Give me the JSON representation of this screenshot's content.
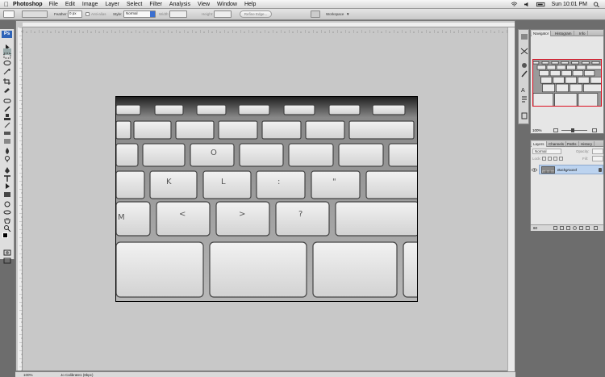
{
  "menubar": {
    "app_name": "Photoshop",
    "menus": [
      "File",
      "Edit",
      "Image",
      "Layer",
      "Select",
      "Filter",
      "Analysis",
      "View",
      "Window",
      "Help"
    ],
    "clock": "Sun 10:01 PM"
  },
  "options_bar": {
    "feather_label": "Feather:",
    "feather_value": "0 px",
    "anti_alias_label": "Anti-alias",
    "style_label": "Style:",
    "style_value": "Normal",
    "width_label": "Width:",
    "height_label": "Height:",
    "refine_edge_label": "Refine Edge...",
    "workspace_label": "Workspace"
  },
  "toolbox": {
    "logo": "Ps"
  },
  "status_bar": {
    "zoom": "100%",
    "document_info": "Jo Calibrate1 (8bpc)"
  },
  "navigator_panel": {
    "tabs": [
      "Navigator",
      "Histogram",
      "Info"
    ],
    "zoom": "100%"
  },
  "layers_panel": {
    "tabs": [
      "Layers",
      "Channels",
      "Paths",
      "History"
    ],
    "blend_mode": "Normal",
    "opacity_label": "Opacity:",
    "lock_label": "Lock:",
    "fill_label": "Fill:",
    "layer_name": "Background",
    "footer_label": "60"
  },
  "colors": {
    "menubar": "#e6e6e6",
    "workspace": "#6d6d6d",
    "canvas_bg": "#c8c8c8",
    "layer_selected": "#bcd3ef",
    "ps_logo": "#2e64b8"
  }
}
